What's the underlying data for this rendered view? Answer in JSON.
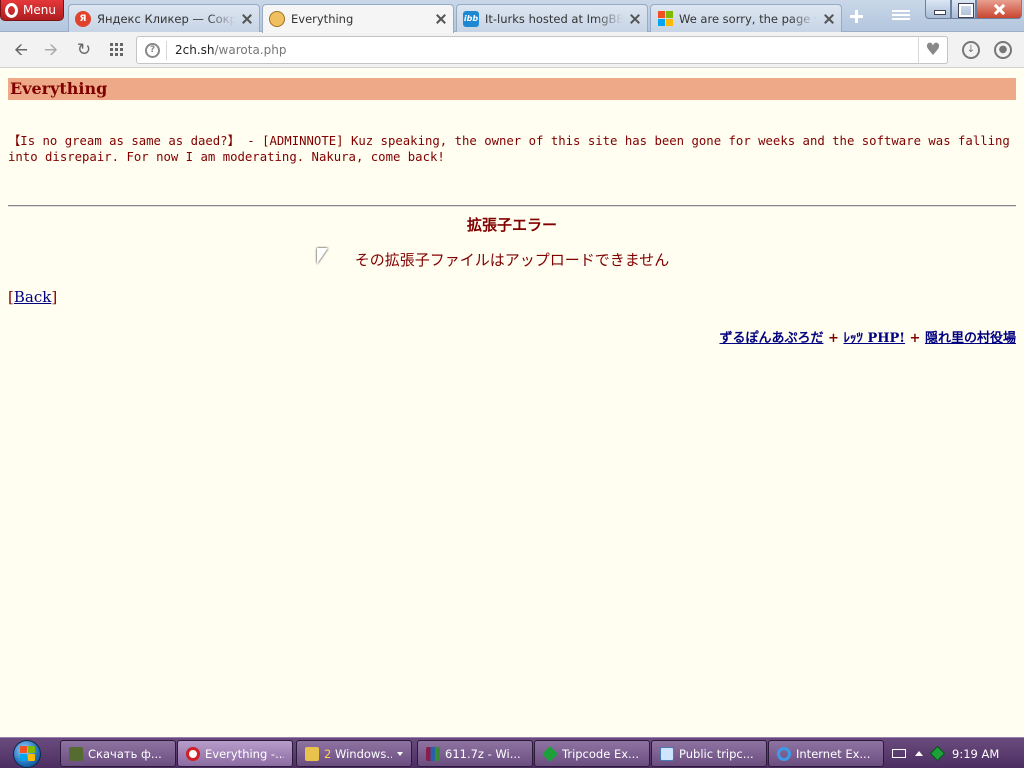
{
  "browser": {
    "menu_label": "Menu",
    "tabs": [
      {
        "title": "Яндекс Кликер — Сокращатель ссылок",
        "favicon": "yandex-icon"
      },
      {
        "title": "Everything",
        "favicon": "everything-icon"
      },
      {
        "title": "It-lurks hosted at ImgBB — ImgBB",
        "favicon": "imgbb-icon"
      },
      {
        "title": "We are sorry, the page you requested",
        "favicon": "microsoft-icon"
      }
    ],
    "active_tab": 1,
    "address": {
      "host": "2ch.sh",
      "path": "/warota.php"
    }
  },
  "page": {
    "banner_title": "Everything",
    "notice": "【Is no gream as same as daed?】 - [ADMINNOTE] Kuz speaking, the owner of this site has been gone for weeks and the software was falling into disrepair. For now I am moderating. Nakura, come back!",
    "error_title": "拡張子エラー",
    "error_message": "その拡張子ファイルはアップロードできません",
    "back_bracket_open": "[",
    "back_link": "Back",
    "back_bracket_close": "]",
    "footer_links": [
      "ずるぽんあぷろだ",
      "ﾚｯﾂ PHP!",
      "隠れ里の村役場"
    ],
    "footer_separator": "+",
    "colors": {
      "background": "#fffef0",
      "banner": "#eeaa88",
      "text": "#800000",
      "link": "#000080"
    }
  },
  "taskbar": {
    "items": [
      {
        "label": "Скачать ф...",
        "icon": "download-icon"
      },
      {
        "label": "Everything -...",
        "icon": "opera-icon"
      },
      {
        "label_prefix": "2",
        "label": " Windows...",
        "icon": "folder-icon"
      },
      {
        "label": "611.7z - Wi...",
        "icon": "winrar-icon"
      },
      {
        "label": "Tripcode Ex...",
        "icon": "tripcode-icon"
      },
      {
        "label": "Public tripc...",
        "icon": "document-icon"
      },
      {
        "label": "Internet Ex...",
        "icon": "internet-explorer-icon"
      }
    ],
    "active_item": 1,
    "clock": "9:19 AM"
  }
}
